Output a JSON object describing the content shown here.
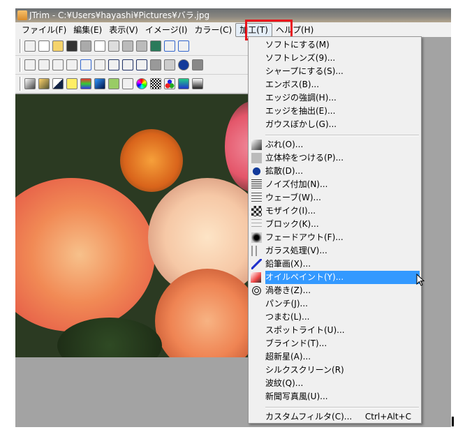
{
  "window": {
    "title": "JTrim - C:¥Users¥hayashi¥Pictures¥バラ.jpg"
  },
  "menubar": [
    "ファイル(F)",
    "編集(E)",
    "表示(V)",
    "イメージ(I)",
    "カラー(C)",
    "加工(T)",
    "ヘルプ(H)"
  ],
  "menubar_active": "加工(T)",
  "dropdown": {
    "group1": [
      "ソフトにする(M)",
      "ソフトレンズ(9)...",
      "シャープにする(S)...",
      "エンボス(B)...",
      "エッジの強調(H)...",
      "エッジを抽出(E)...",
      "ガウスぼかし(G)..."
    ],
    "group2": [
      {
        "label": "ぶれ(O)...",
        "icon": "blur-icon"
      },
      {
        "label": "立体枠をつける(P)...",
        "icon": "frame-icon"
      },
      {
        "label": "拡散(D)...",
        "icon": "diffuse-icon"
      },
      {
        "label": "ノイズ付加(N)...",
        "icon": "noise-icon"
      },
      {
        "label": "ウェーブ(W)...",
        "icon": "wave-icon"
      },
      {
        "label": "モザイク(I)...",
        "icon": "mosaic-icon"
      },
      {
        "label": "ブロック(K)...",
        "icon": "block-icon"
      },
      {
        "label": "フェードアウト(F)...",
        "icon": "fadeout-icon"
      },
      {
        "label": "ガラス処理(V)...",
        "icon": "glass-icon"
      },
      {
        "label": "鉛筆画(X)...",
        "icon": "pencil-icon"
      },
      {
        "label": "オイルペイント(Y)...",
        "icon": "oilpaint-icon"
      },
      {
        "label": "渦巻き(Z)...",
        "icon": "swirl-icon"
      },
      {
        "label": "パンチ(J)...",
        "icon": ""
      },
      {
        "label": "つまむ(L)...",
        "icon": ""
      },
      {
        "label": "スポットライト(U)...",
        "icon": ""
      },
      {
        "label": "ブラインド(T)...",
        "icon": ""
      },
      {
        "label": "超新星(A)...",
        "icon": ""
      },
      {
        "label": "シルクスクリーン(R)",
        "icon": ""
      },
      {
        "label": "波紋(Q)...",
        "icon": ""
      },
      {
        "label": "新聞写真風(U)...",
        "icon": ""
      }
    ],
    "highlighted": "オイルペイント(Y)...",
    "custom": {
      "label": "カスタムフィルタ(C)...",
      "shortcut": "Ctrl+Alt+C"
    }
  },
  "colors": {
    "highlight": "#3399ff",
    "annotation": "#e8141c"
  }
}
